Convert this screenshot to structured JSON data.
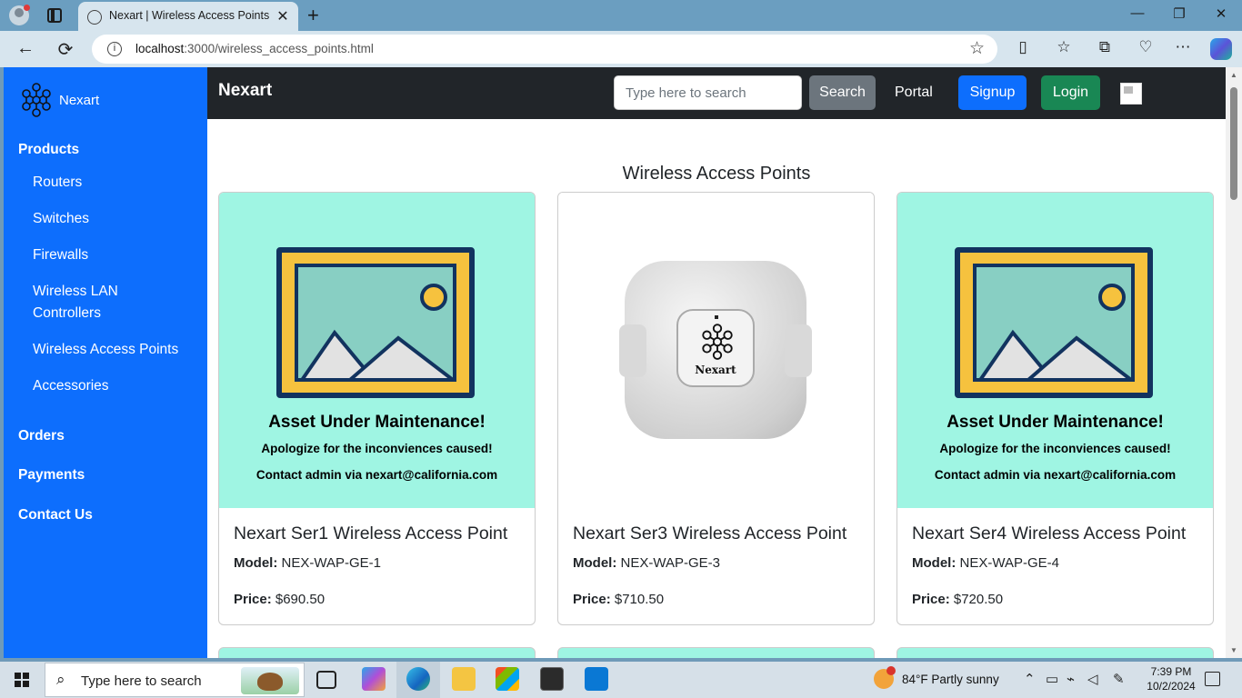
{
  "browser": {
    "tab_title": "Nexart | Wireless Access Points",
    "tab_close": "✕",
    "new_tab": "+",
    "url_host": "localhost",
    "url_rest": ":3000/wireless_access_points.html",
    "window_controls": {
      "minimize": "—",
      "restore": "❐",
      "close": "✕"
    }
  },
  "sidebar": {
    "brand": "Nexart",
    "categories": [
      {
        "label": "Products"
      },
      {
        "label": "Orders"
      },
      {
        "label": "Payments"
      },
      {
        "label": "Contact Us"
      }
    ],
    "product_items": [
      {
        "label": "Routers"
      },
      {
        "label": "Switches"
      },
      {
        "label": "Firewalls"
      },
      {
        "label": "Wireless LAN Controllers"
      },
      {
        "label": "Wireless Access Points"
      },
      {
        "label": "Accessories"
      }
    ]
  },
  "navbar": {
    "brand": "Nexart",
    "search_placeholder": "Type here to search",
    "search_button": "Search",
    "portal_link": "Portal",
    "signup_button": "Signup",
    "login_button": "Login"
  },
  "page": {
    "title": "Wireless Access Points"
  },
  "maintenance_image": {
    "heading": "Asset Under Maintenance!",
    "line1": "Apologize for the inconviences caused!",
    "line2": "Contact admin via nexart@california.com"
  },
  "device_image": {
    "label": "Nexart"
  },
  "products": [
    {
      "name": "Nexart Ser1 Wireless Access Point",
      "model_label": "Model:",
      "model": "NEX-WAP-GE-1",
      "price_label": "Price:",
      "price": "$690.50",
      "image": "maintenance"
    },
    {
      "name": "Nexart Ser3 Wireless Access Point",
      "model_label": "Model:",
      "model": "NEX-WAP-GE-3",
      "price_label": "Price:",
      "price": "$710.50",
      "image": "device"
    },
    {
      "name": "Nexart Ser4 Wireless Access Point",
      "model_label": "Model:",
      "model": "NEX-WAP-GE-4",
      "price_label": "Price:",
      "price": "$720.50",
      "image": "maintenance"
    }
  ],
  "taskbar": {
    "search_placeholder": "Type here to search",
    "weather": "84°F  Partly sunny",
    "time": "7:39 PM",
    "date": "10/2/2024"
  },
  "colors": {
    "sidebar": "#0d6efd",
    "navbar": "#212529",
    "signup": "#0d6efd",
    "login": "#198754",
    "search_btn": "#6c757d",
    "maintenance_bg": "#9ff5e3"
  }
}
